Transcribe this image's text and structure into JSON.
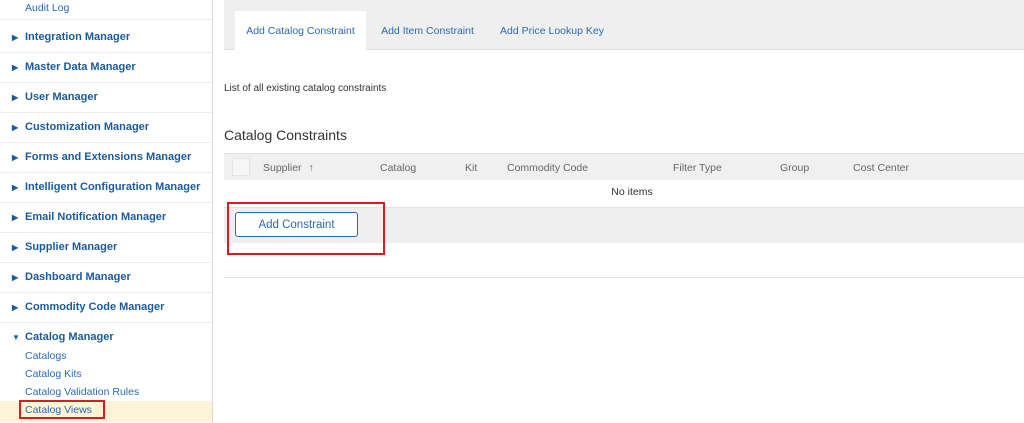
{
  "sidebar": {
    "top_item": "Audit Log",
    "sections": [
      {
        "label": "Integration Manager",
        "expanded": false
      },
      {
        "label": "Master Data Manager",
        "expanded": false
      },
      {
        "label": "User Manager",
        "expanded": false
      },
      {
        "label": "Customization Manager",
        "expanded": false
      },
      {
        "label": "Forms and Extensions Manager",
        "expanded": false
      },
      {
        "label": "Intelligent Configuration Manager",
        "expanded": false
      },
      {
        "label": "Email Notification Manager",
        "expanded": false
      },
      {
        "label": "Supplier Manager",
        "expanded": false
      },
      {
        "label": "Dashboard Manager",
        "expanded": false
      },
      {
        "label": "Commodity Code Manager",
        "expanded": false
      },
      {
        "label": "Catalog Manager",
        "expanded": true
      }
    ],
    "catalog_manager_items": [
      "Catalogs",
      "Catalog Kits",
      "Catalog Validation Rules",
      "Catalog Views"
    ],
    "selected_item": "Catalog Views"
  },
  "tabs": [
    {
      "label": "Add Catalog Constraint",
      "active": true
    },
    {
      "label": "Add Item Constraint",
      "active": false
    },
    {
      "label": "Add Price Lookup Key",
      "active": false
    }
  ],
  "description": "List of all existing catalog constraints",
  "section_title": "Catalog Constraints",
  "table": {
    "columns": [
      "Supplier",
      "Catalog",
      "Kit",
      "Commodity Code",
      "Filter Type",
      "Group",
      "Cost Center"
    ],
    "sort_indicator": "↑",
    "empty_text": "No items"
  },
  "add_button_label": "Add Constraint",
  "colors": {
    "link": "#2a6bb5",
    "section": "#1a5a9e",
    "highlight_box": "#d01f27",
    "selected_bg": "#fdf3d7"
  }
}
